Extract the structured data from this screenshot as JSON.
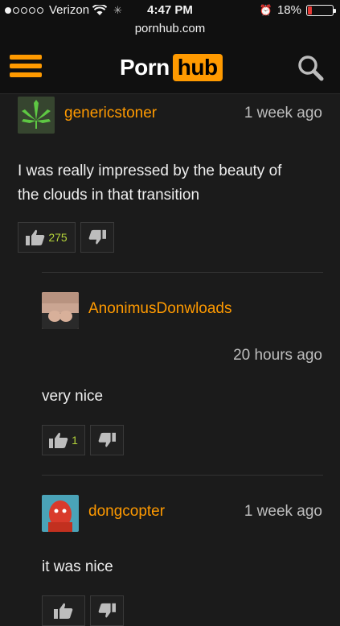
{
  "status_bar": {
    "carrier": "Verizon",
    "time": "4:47 PM",
    "battery": "18%",
    "battery_level": 0.18
  },
  "browser": {
    "url": "pornhub.com"
  },
  "header": {
    "logo_part1": "Porn",
    "logo_part2": "hub",
    "menu_icon": "hamburger-icon",
    "search_icon": "search-icon"
  },
  "comments": [
    {
      "username": "genericstoner",
      "time": "1 week ago",
      "text_line1": "I was really impressed by the beauty of",
      "text_line2": "the clouds in that transition",
      "likes": "275",
      "avatar_icon": "cannabis-leaf-avatar"
    },
    {
      "username": "AnonimusDonwloads",
      "time": "20 hours ago",
      "text": "very nice",
      "likes": "1",
      "avatar_icon": "user-photo-avatar"
    },
    {
      "username": "dongcopter",
      "time": "1 week ago",
      "text": "it was nice",
      "avatar_icon": "red-character-avatar"
    }
  ],
  "colors": {
    "accent": "#ff9a00",
    "background": "#1b1b1b",
    "like_count": "#b4d33a"
  }
}
